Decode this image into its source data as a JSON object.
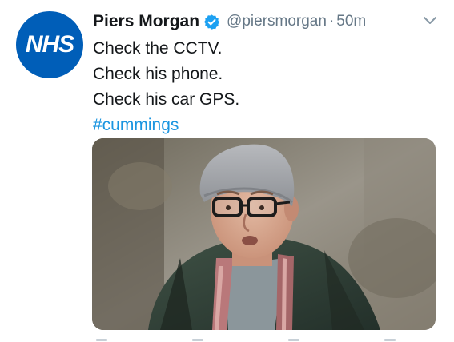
{
  "tweet": {
    "author": {
      "display_name": "Piers Morgan",
      "handle": "@piersmorgan",
      "avatar_text": "NHS",
      "avatar_color": "#005eb8",
      "verified_icon": "verified-badge-icon",
      "verified_color": "#1da1f2"
    },
    "separator": "·",
    "timestamp": "50m",
    "menu_icon": "chevron-down-icon",
    "body_lines": [
      "Check the CCTV.",
      "Check his phone.",
      "Check his car GPS."
    ],
    "hashtag": "#cummings",
    "colors": {
      "text": "#14171a",
      "secondary": "#657786",
      "link": "#1b95e0"
    }
  }
}
